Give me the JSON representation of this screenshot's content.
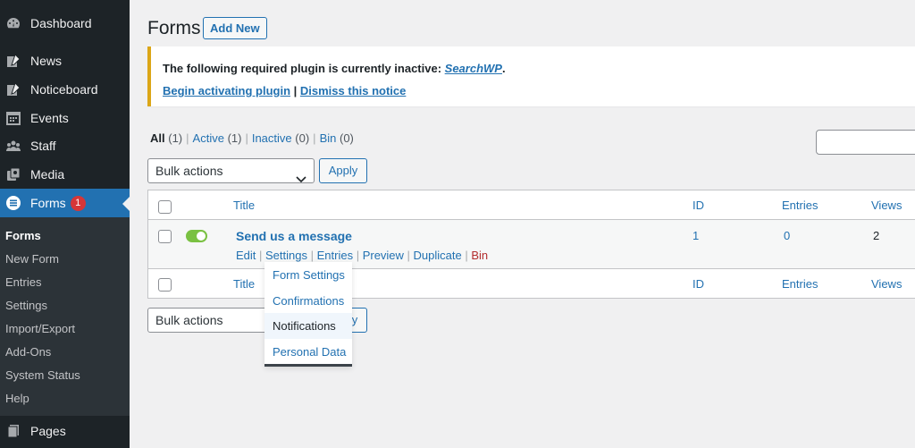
{
  "sidebar": {
    "items": [
      {
        "label": "Dashboard",
        "icon": "dashboard-icon"
      },
      {
        "label": "News",
        "icon": "pin-icon"
      },
      {
        "label": "Noticeboard",
        "icon": "pin-icon"
      },
      {
        "label": "Events",
        "icon": "calendar-icon"
      },
      {
        "label": "Staff",
        "icon": "groups-icon"
      },
      {
        "label": "Media",
        "icon": "media-icon"
      },
      {
        "label": "Forms",
        "icon": "forms-icon",
        "badge": "1"
      },
      {
        "label": "Pages",
        "icon": "page-icon"
      }
    ],
    "submenu": [
      "Forms",
      "New Form",
      "Entries",
      "Settings",
      "Import/Export",
      "Add-Ons",
      "System Status",
      "Help"
    ]
  },
  "header": {
    "title": "Forms",
    "add_new": "Add New"
  },
  "notice": {
    "prefix": "The following required plugin is currently inactive: ",
    "plugin": "SearchWP",
    "suffix": ".",
    "activate": "Begin activating plugin",
    "sep": " | ",
    "dismiss": "Dismiss this notice"
  },
  "filters": [
    {
      "label": "All",
      "count": "(1)"
    },
    {
      "label": "Active",
      "count": "(1)"
    },
    {
      "label": "Inactive",
      "count": "(0)"
    },
    {
      "label": "Bin",
      "count": "(0)"
    }
  ],
  "bulk": {
    "label": "Bulk actions",
    "apply": "Apply"
  },
  "table": {
    "columns": [
      "Title",
      "ID",
      "Entries",
      "Views"
    ],
    "rows": [
      {
        "title": "Send us a message",
        "id": "1",
        "entries": "0",
        "views": "2",
        "active": true,
        "actions": [
          "Edit",
          "Settings",
          "Entries",
          "Preview",
          "Duplicate",
          "Bin"
        ]
      }
    ]
  },
  "dropdown": [
    "Form Settings",
    "Confirmations",
    "Notifications",
    "Personal Data"
  ],
  "colors": {
    "sidebar": "#1d2327",
    "accent": "#2271b1",
    "notice_border": "#dba617",
    "toggle_on": "#7ac142",
    "badge": "#d63638",
    "danger": "#b32d2e"
  }
}
